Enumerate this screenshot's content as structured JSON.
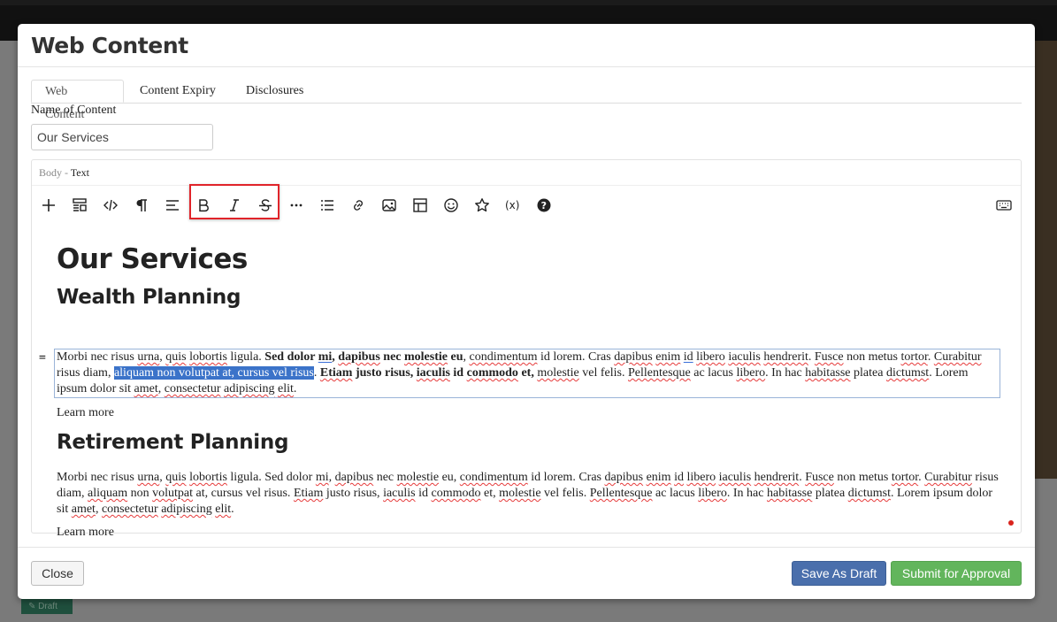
{
  "modal": {
    "title": "Web Content",
    "tabs": [
      "Web Content",
      "Content Expiry",
      "Disclosures"
    ],
    "active_tab": "Web Content"
  },
  "form": {
    "name_label": "Name of Content",
    "name_value": "Our Services",
    "body_label_prefix": "Body -",
    "body_label_type": "Text"
  },
  "toolbar": {
    "icons": [
      "plus-icon",
      "template-icon",
      "code-icon",
      "paragraph-icon",
      "align-left-icon",
      "bold-icon",
      "italic-icon",
      "strikethrough-icon",
      "more-icon",
      "list-icon",
      "link-icon",
      "image-icon",
      "table-icon",
      "emoji-icon",
      "star-icon",
      "variable-icon",
      "help-icon",
      "keyboard-icon"
    ]
  },
  "content": {
    "h1": "Our Services",
    "section1": {
      "heading": "Wealth Planning",
      "learn_more": "Learn more"
    },
    "section2": {
      "heading": "Retirement Planning",
      "learn_more": "Learn more"
    },
    "drag_handle": "="
  },
  "footer": {
    "close": "Close",
    "save_draft": "Save As Draft",
    "submit": "Submit for Approval"
  },
  "backdrop": {
    "badge": "Draft"
  },
  "colors": {
    "accent_blue": "#4a6fac",
    "accent_green": "#62b55c",
    "highlight_red": "#e0242a",
    "selection": "#3b73c9"
  }
}
